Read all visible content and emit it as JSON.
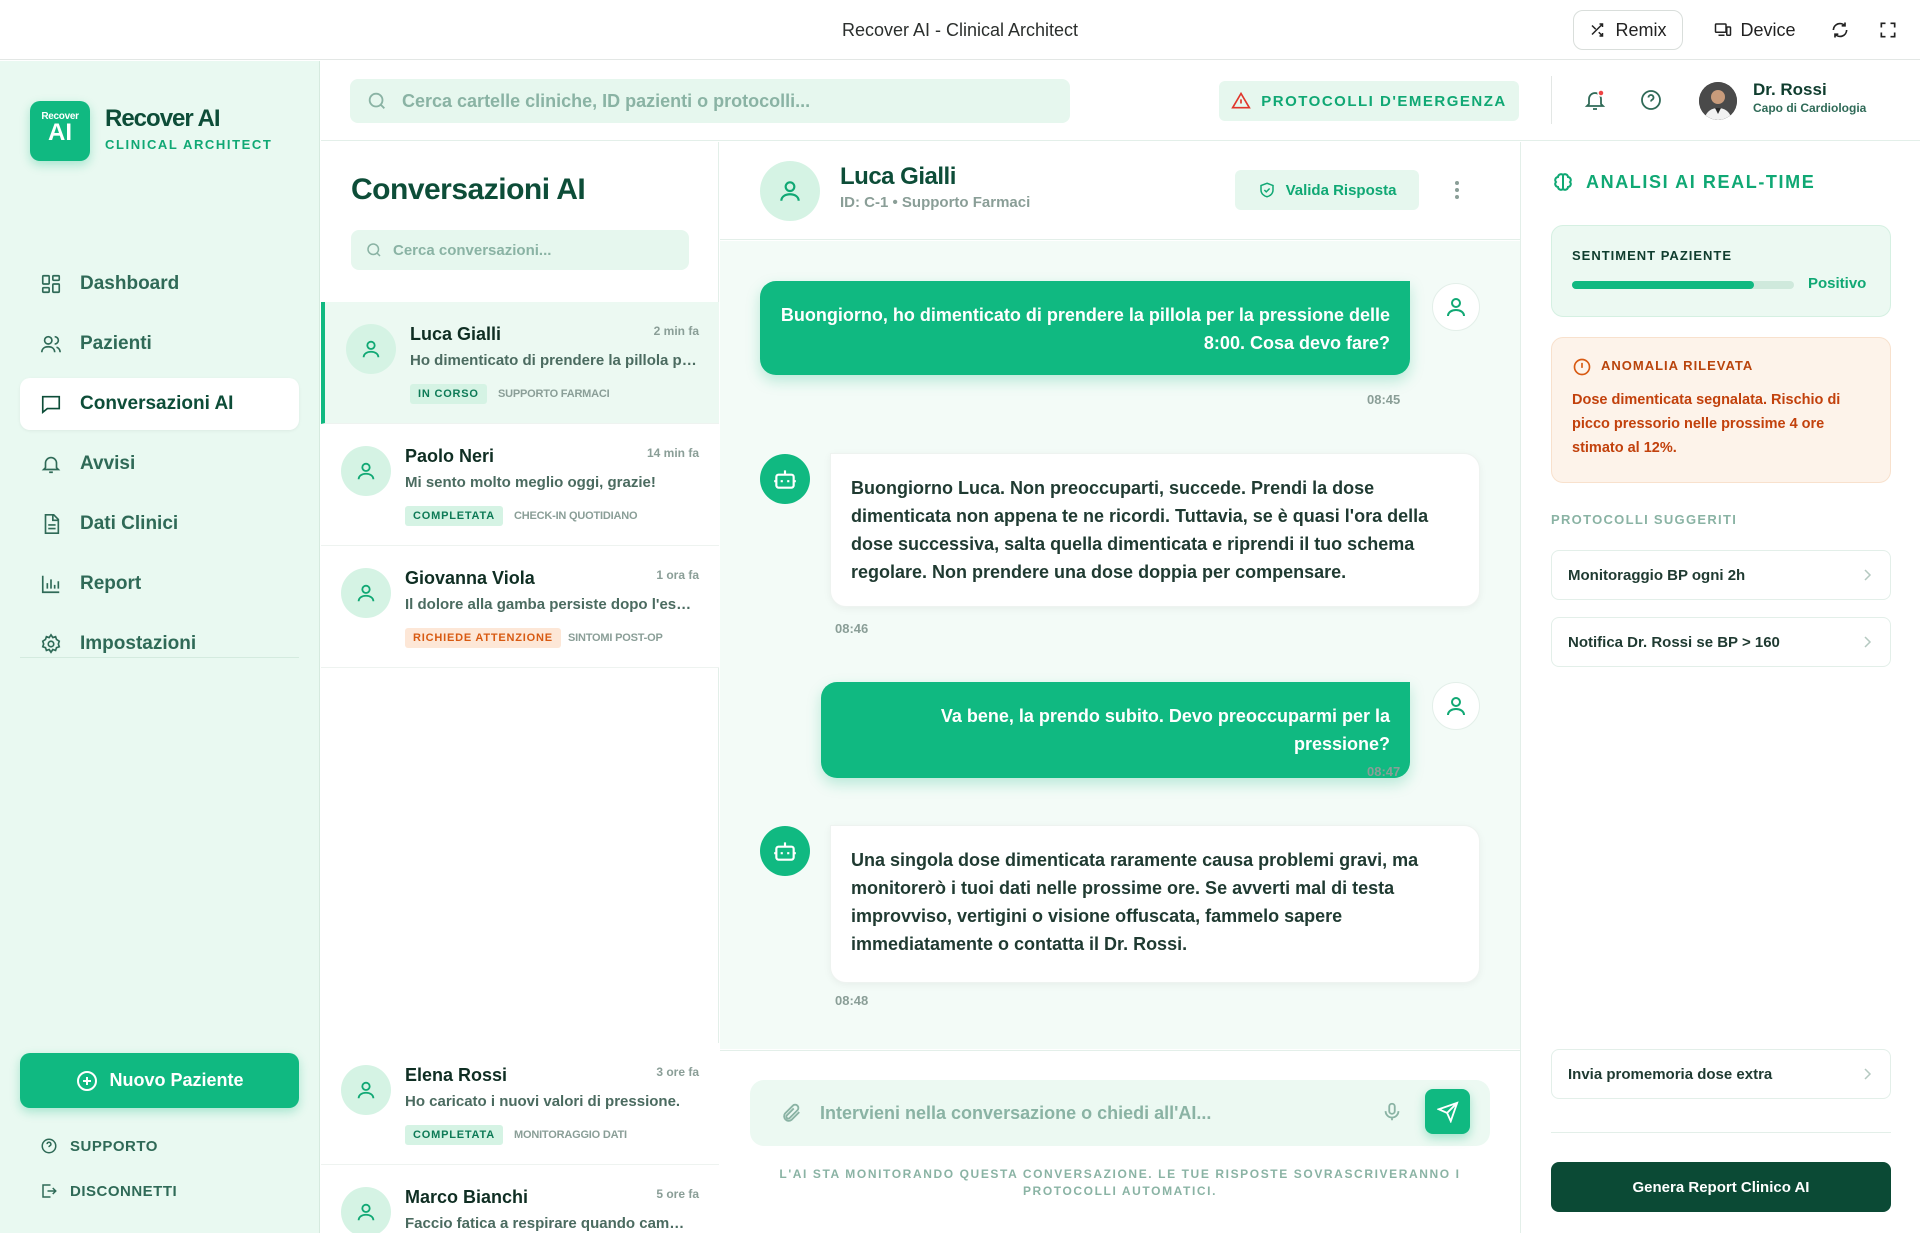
{
  "window": {
    "title": "Recover AI - Clinical Architect",
    "remix_label": "Remix",
    "device_label": "Device"
  },
  "brand": {
    "logo_small": "Recover",
    "logo_big": "AI",
    "name": "Recover AI",
    "subtitle": "CLINICAL ARCHITECT"
  },
  "nav": {
    "items": [
      {
        "label": "Dashboard",
        "icon": "dashboard-icon"
      },
      {
        "label": "Pazienti",
        "icon": "users-icon"
      },
      {
        "label": "Conversazioni AI",
        "icon": "chat-icon",
        "active": true
      },
      {
        "label": "Avvisi",
        "icon": "bell-icon"
      },
      {
        "label": "Dati Clinici",
        "icon": "document-icon"
      },
      {
        "label": "Report",
        "icon": "bar-chart-icon"
      },
      {
        "label": "Impostazioni",
        "icon": "gear-icon"
      }
    ],
    "new_patient": "Nuovo Paziente",
    "support": "SUPPORTO",
    "logout": "DISCONNETTI"
  },
  "header": {
    "search_placeholder": "Cerca cartelle cliniche, ID pazienti o protocolli...",
    "emergency_label": "PROTOCOLLI D'EMERGENZA",
    "doctor_name": "Dr. Rossi",
    "doctor_role": "Capo di Cardiologia"
  },
  "conversations": {
    "title": "Conversazioni AI",
    "search_placeholder": "Cerca conversazioni...",
    "items": [
      {
        "name": "Luca Gialli",
        "time": "2 min fa",
        "message": "Ho dimenticato di prendere la pillola per la pressione",
        "status": "IN CORSO",
        "category": "SUPPORTO FARMACI"
      },
      {
        "name": "Paolo Neri",
        "time": "14 min fa",
        "message": "Mi sento molto meglio oggi, grazie!",
        "status": "COMPLETATA",
        "category": "CHECK-IN QUOTIDIANO"
      },
      {
        "name": "Giovanna Viola",
        "time": "1 ora fa",
        "message": "Il dolore alla gamba persiste dopo l'esercizio",
        "status": "RICHIEDE ATTENZIONE",
        "category": "SINTOMI POST-OP"
      },
      {
        "name": "Elena Rossi",
        "time": "3 ore fa",
        "message": "Ho caricato i nuovi valori di pressione.",
        "status": "COMPLETATA",
        "category": "MONITORAGGIO DATI"
      },
      {
        "name": "Marco Bianchi",
        "time": "5 ore fa",
        "message": "Faccio fatica a respirare quando cammino",
        "status": "",
        "category": ""
      }
    ]
  },
  "chat": {
    "patient_name": "Luca Gialli",
    "patient_meta": "ID: C-1 • Supporto Farmaci",
    "validate_label": "Valida Risposta",
    "messages": [
      {
        "from": "user",
        "text": "Buongiorno, ho dimenticato di prendere la pillola per la pressione delle 8:00. Cosa devo fare?",
        "time": "08:45"
      },
      {
        "from": "ai",
        "text": "Buongiorno Luca. Non preoccuparti, succede. Prendi la dose dimenticata non appena te ne ricordi. Tuttavia, se è quasi l'ora della dose successiva, salta quella dimenticata e riprendi il tuo schema regolare. Non prendere una dose doppia per compensare.",
        "time": "08:46"
      },
      {
        "from": "user",
        "text": "Va bene, la prendo subito. Devo preoccuparmi per la pressione?",
        "time": "08:47"
      },
      {
        "from": "ai",
        "text": "Una singola dose dimenticata raramente causa problemi gravi, ma monitorerò i tuoi dati nelle prossime ore. Se avverti mal di testa improvviso, vertigini o visione offuscata, fammelo sapere immediatamente o contatta il Dr. Rossi.",
        "time": "08:48"
      }
    ],
    "input_placeholder": "Intervieni nella conversazione o chiedi all'AI...",
    "footer_note": "L'AI STA MONITORANDO QUESTA CONVERSAZIONE. LE TUE RISPOSTE SOVRASCRIVERANNO I PROTOCOLLI AUTOMATICI."
  },
  "analysis": {
    "title": "ANALISI AI REAL-TIME",
    "sentiment_label": "SENTIMENT PAZIENTE",
    "sentiment_value": "Positivo",
    "sentiment_level": 0.82,
    "anomaly_title": "ANOMALIA RILEVATA",
    "anomaly_text": "Dose dimenticata segnalata. Rischio di picco pressorio nelle prossime 4 ore stimato al 12%.",
    "protocols_label": "PROTOCOLLI SUGGERITI",
    "protocols": [
      "Monitoraggio BP ogni 2h",
      "Notifica Dr. Rossi se BP > 160"
    ],
    "extra_protocol": "Invia promemoria dose extra",
    "report_button": "Genera Report Clinico AI"
  },
  "colors": {
    "accent": "#10b981",
    "dark": "#0b4a35",
    "warning": "#c2410c"
  }
}
